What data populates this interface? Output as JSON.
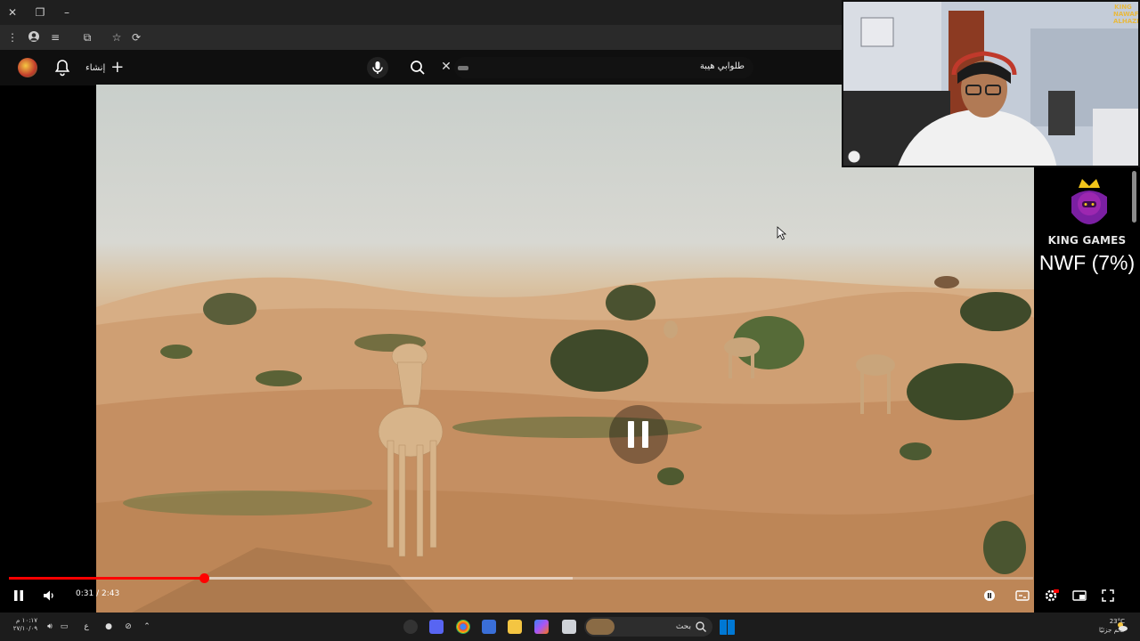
{
  "search": {
    "query": "طلوابي هيبة"
  },
  "header": {
    "create_label": "إنشاء"
  },
  "player": {
    "time_current": "0:31",
    "time_total": "2:43",
    "time_display": "0:31 / 2:43",
    "progress_fraction": 0.19,
    "buffer_fraction": 0.55
  },
  "overlay": {
    "brand": "KING GAMES",
    "nwf": "NWF (7%)",
    "watermark": "KING NAWAF ALHAZMI"
  },
  "taskbar": {
    "search_label": "بحث",
    "clock_time": "١٠:١٧ م",
    "clock_date": "٢٧/١٠/٠٩",
    "weather_temp": "23°C",
    "weather_desc": "غائم جزئيًا",
    "lang_indicator": "ع"
  },
  "colors": {
    "accent": "#ff0000",
    "background": "#000000"
  }
}
